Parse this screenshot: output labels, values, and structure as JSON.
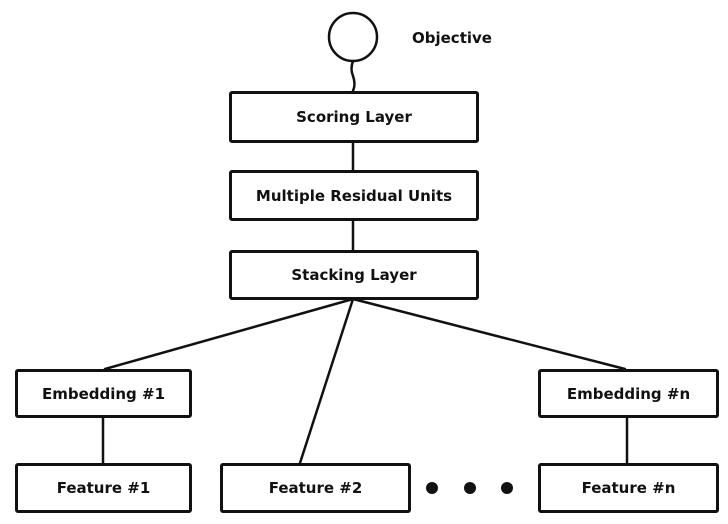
{
  "objective": {
    "label": "Objective"
  },
  "layers": {
    "scoring": "Scoring Layer",
    "residual": "Multiple Residual Units",
    "stacking": "Stacking Layer"
  },
  "embeddings": [
    "Embedding #1",
    "Embedding #n"
  ],
  "features": [
    "Feature #1",
    "Feature #2",
    "Feature #n"
  ]
}
